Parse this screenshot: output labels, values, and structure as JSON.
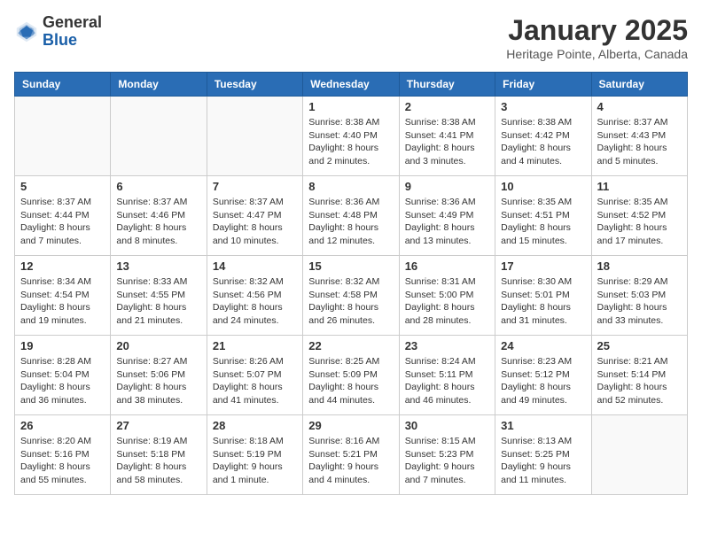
{
  "header": {
    "logo": {
      "general": "General",
      "blue": "Blue"
    },
    "title": "January 2025",
    "location": "Heritage Pointe, Alberta, Canada"
  },
  "weekdays": [
    "Sunday",
    "Monday",
    "Tuesday",
    "Wednesday",
    "Thursday",
    "Friday",
    "Saturday"
  ],
  "weeks": [
    [
      {
        "day": "",
        "info": ""
      },
      {
        "day": "",
        "info": ""
      },
      {
        "day": "",
        "info": ""
      },
      {
        "day": "1",
        "info": "Sunrise: 8:38 AM\nSunset: 4:40 PM\nDaylight: 8 hours\nand 2 minutes."
      },
      {
        "day": "2",
        "info": "Sunrise: 8:38 AM\nSunset: 4:41 PM\nDaylight: 8 hours\nand 3 minutes."
      },
      {
        "day": "3",
        "info": "Sunrise: 8:38 AM\nSunset: 4:42 PM\nDaylight: 8 hours\nand 4 minutes."
      },
      {
        "day": "4",
        "info": "Sunrise: 8:37 AM\nSunset: 4:43 PM\nDaylight: 8 hours\nand 5 minutes."
      }
    ],
    [
      {
        "day": "5",
        "info": "Sunrise: 8:37 AM\nSunset: 4:44 PM\nDaylight: 8 hours\nand 7 minutes."
      },
      {
        "day": "6",
        "info": "Sunrise: 8:37 AM\nSunset: 4:46 PM\nDaylight: 8 hours\nand 8 minutes."
      },
      {
        "day": "7",
        "info": "Sunrise: 8:37 AM\nSunset: 4:47 PM\nDaylight: 8 hours\nand 10 minutes."
      },
      {
        "day": "8",
        "info": "Sunrise: 8:36 AM\nSunset: 4:48 PM\nDaylight: 8 hours\nand 12 minutes."
      },
      {
        "day": "9",
        "info": "Sunrise: 8:36 AM\nSunset: 4:49 PM\nDaylight: 8 hours\nand 13 minutes."
      },
      {
        "day": "10",
        "info": "Sunrise: 8:35 AM\nSunset: 4:51 PM\nDaylight: 8 hours\nand 15 minutes."
      },
      {
        "day": "11",
        "info": "Sunrise: 8:35 AM\nSunset: 4:52 PM\nDaylight: 8 hours\nand 17 minutes."
      }
    ],
    [
      {
        "day": "12",
        "info": "Sunrise: 8:34 AM\nSunset: 4:54 PM\nDaylight: 8 hours\nand 19 minutes."
      },
      {
        "day": "13",
        "info": "Sunrise: 8:33 AM\nSunset: 4:55 PM\nDaylight: 8 hours\nand 21 minutes."
      },
      {
        "day": "14",
        "info": "Sunrise: 8:32 AM\nSunset: 4:56 PM\nDaylight: 8 hours\nand 24 minutes."
      },
      {
        "day": "15",
        "info": "Sunrise: 8:32 AM\nSunset: 4:58 PM\nDaylight: 8 hours\nand 26 minutes."
      },
      {
        "day": "16",
        "info": "Sunrise: 8:31 AM\nSunset: 5:00 PM\nDaylight: 8 hours\nand 28 minutes."
      },
      {
        "day": "17",
        "info": "Sunrise: 8:30 AM\nSunset: 5:01 PM\nDaylight: 8 hours\nand 31 minutes."
      },
      {
        "day": "18",
        "info": "Sunrise: 8:29 AM\nSunset: 5:03 PM\nDaylight: 8 hours\nand 33 minutes."
      }
    ],
    [
      {
        "day": "19",
        "info": "Sunrise: 8:28 AM\nSunset: 5:04 PM\nDaylight: 8 hours\nand 36 minutes."
      },
      {
        "day": "20",
        "info": "Sunrise: 8:27 AM\nSunset: 5:06 PM\nDaylight: 8 hours\nand 38 minutes."
      },
      {
        "day": "21",
        "info": "Sunrise: 8:26 AM\nSunset: 5:07 PM\nDaylight: 8 hours\nand 41 minutes."
      },
      {
        "day": "22",
        "info": "Sunrise: 8:25 AM\nSunset: 5:09 PM\nDaylight: 8 hours\nand 44 minutes."
      },
      {
        "day": "23",
        "info": "Sunrise: 8:24 AM\nSunset: 5:11 PM\nDaylight: 8 hours\nand 46 minutes."
      },
      {
        "day": "24",
        "info": "Sunrise: 8:23 AM\nSunset: 5:12 PM\nDaylight: 8 hours\nand 49 minutes."
      },
      {
        "day": "25",
        "info": "Sunrise: 8:21 AM\nSunset: 5:14 PM\nDaylight: 8 hours\nand 52 minutes."
      }
    ],
    [
      {
        "day": "26",
        "info": "Sunrise: 8:20 AM\nSunset: 5:16 PM\nDaylight: 8 hours\nand 55 minutes."
      },
      {
        "day": "27",
        "info": "Sunrise: 8:19 AM\nSunset: 5:18 PM\nDaylight: 8 hours\nand 58 minutes."
      },
      {
        "day": "28",
        "info": "Sunrise: 8:18 AM\nSunset: 5:19 PM\nDaylight: 9 hours\nand 1 minute."
      },
      {
        "day": "29",
        "info": "Sunrise: 8:16 AM\nSunset: 5:21 PM\nDaylight: 9 hours\nand 4 minutes."
      },
      {
        "day": "30",
        "info": "Sunrise: 8:15 AM\nSunset: 5:23 PM\nDaylight: 9 hours\nand 7 minutes."
      },
      {
        "day": "31",
        "info": "Sunrise: 8:13 AM\nSunset: 5:25 PM\nDaylight: 9 hours\nand 11 minutes."
      },
      {
        "day": "",
        "info": ""
      }
    ]
  ]
}
